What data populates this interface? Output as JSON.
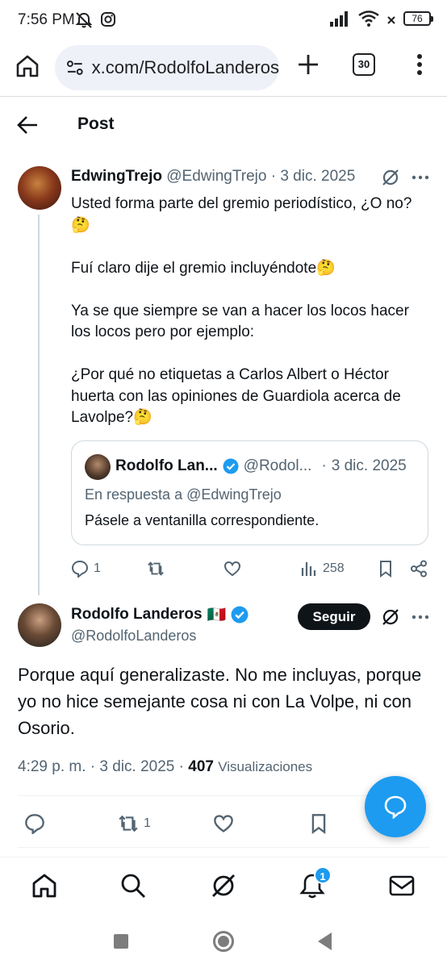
{
  "status_bar": {
    "time": "7:56 PM",
    "battery": "76",
    "icons": [
      "mute-icon",
      "instagram-icon",
      "signal-icon",
      "wifi-icon",
      "wifi-x-icon",
      "battery-icon"
    ]
  },
  "browser": {
    "url": "x.com/RodolfoLanderos",
    "tab_count": "30"
  },
  "header": {
    "title": "Post"
  },
  "tweet1": {
    "name": "EdwingTrejo",
    "handle": "@EdwingTrejo",
    "separator": "·",
    "date": "3 dic. 2025",
    "paragraphs": [
      "Usted forma parte del gremio periodístico, ¿O no?🤔",
      "Fuí claro dije el gremio incluyéndote🤔",
      "Ya se que siempre se van a hacer los locos hacer los locos pero por ejemplo:",
      "¿Por qué no etiquetas a Carlos Albert o Héctor huerta con las opiniones de Guardiola acerca de Lavolpe?🤔"
    ],
    "quote": {
      "name": "Rodolfo Lan...",
      "handle": "@Rodol...",
      "separator": "·",
      "date": "3 dic. 2025",
      "reply_to": "En respuesta a @EdwingTrejo",
      "text": "Pásele a ventanilla correspondiente."
    },
    "actions": {
      "replies": "1",
      "views": "258"
    }
  },
  "tweet2": {
    "name": "Rodolfo Landeros",
    "flag": "🇲🇽",
    "handle": "@RodolfoLanderos",
    "follow_label": "Seguir",
    "text": "Porque aquí generalizaste. No me incluyas, porque yo no hice semejante cosa ni con La Volpe, ni con Osorio.",
    "time": "4:29 p. m.",
    "separator": "·",
    "date": "3 dic. 2025",
    "separator2": "·",
    "views_count": "407",
    "views_label": "Visualizaciones",
    "actions": {
      "reposts": "1"
    }
  },
  "bottom_nav": {
    "notification_count": "1"
  },
  "colors": {
    "accent": "#1d9bf0",
    "text": "#0f1419",
    "muted": "#536471",
    "verified": "#1d9bf0"
  }
}
